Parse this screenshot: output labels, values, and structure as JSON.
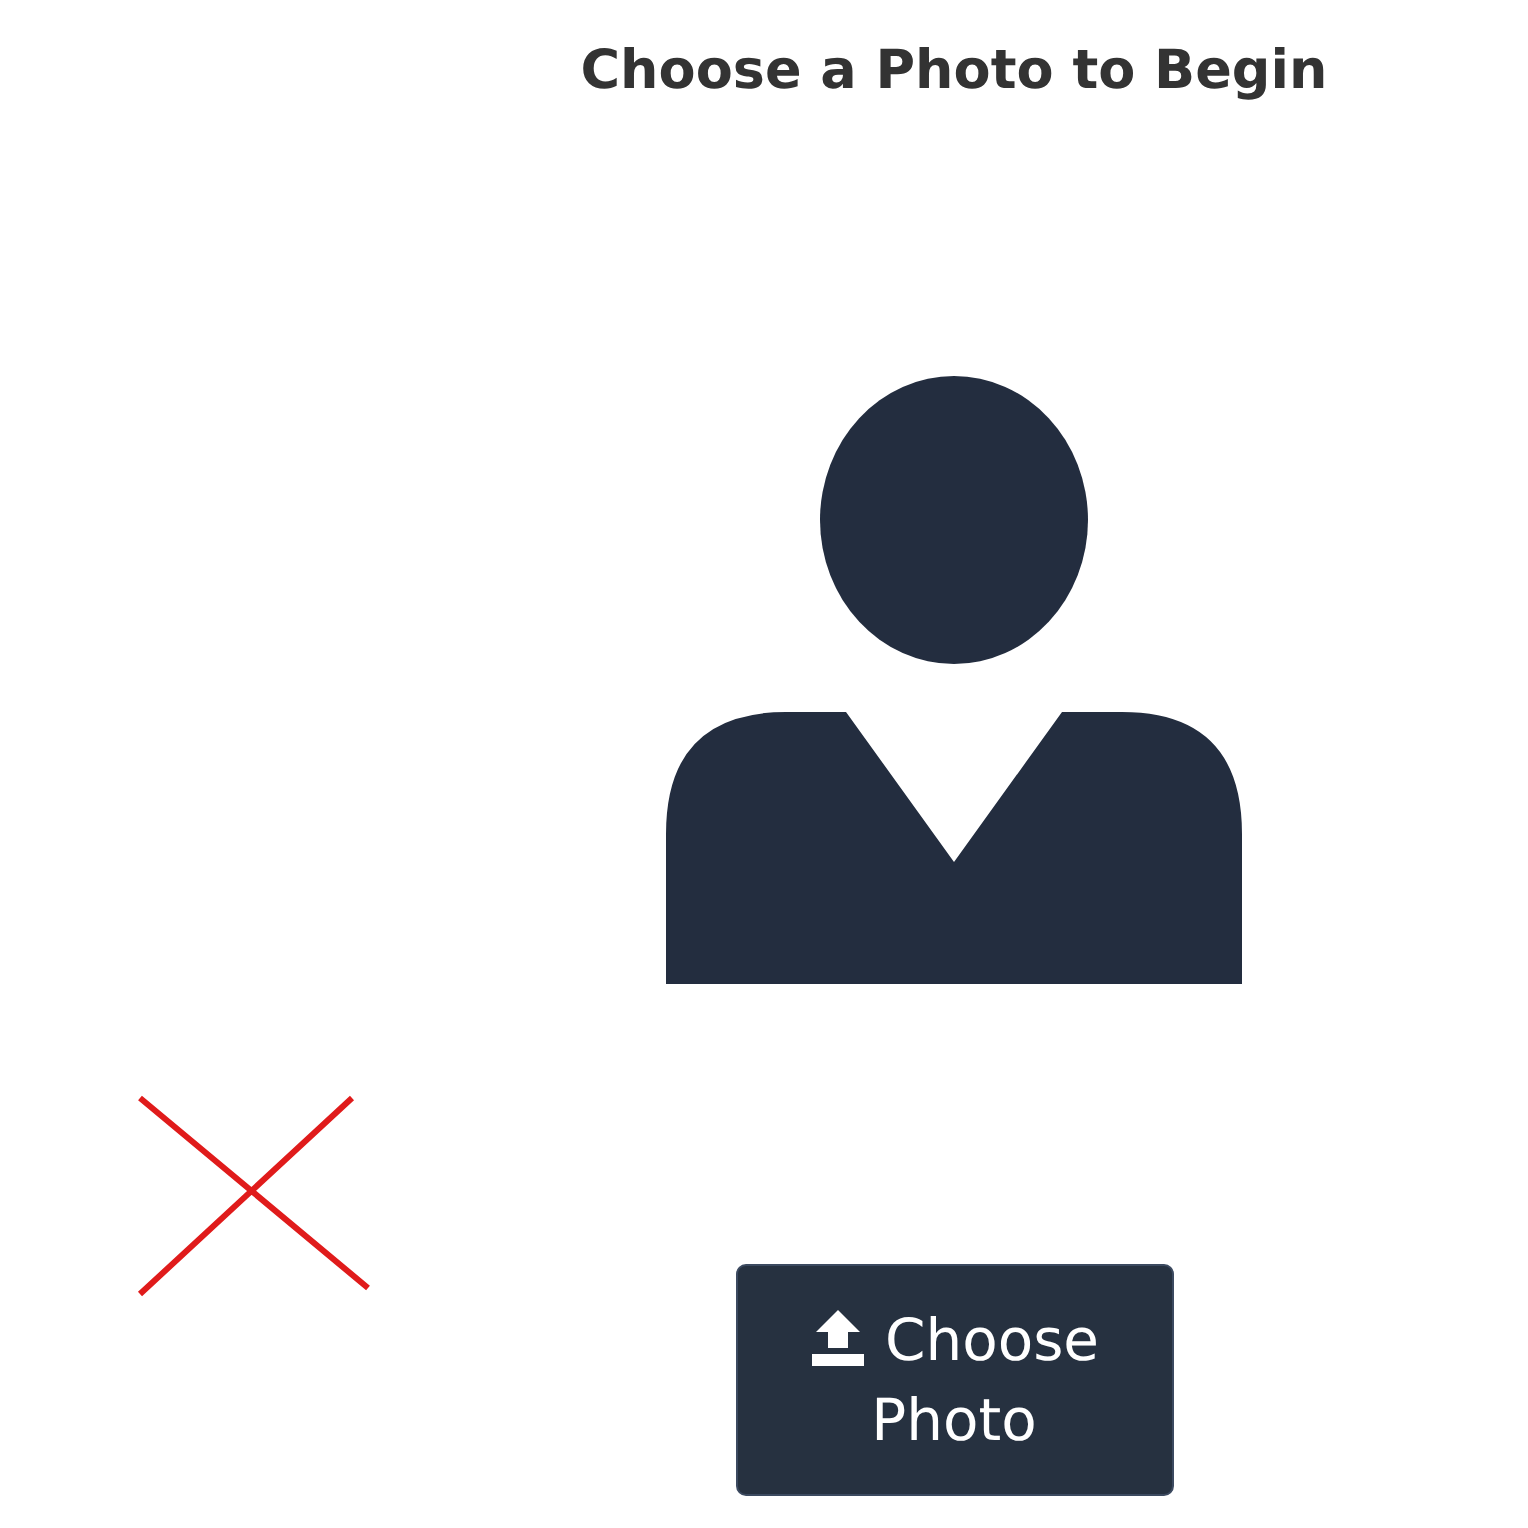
{
  "title": "Choose a Photo to Begin",
  "upload_button": {
    "label": "Choose Photo"
  }
}
